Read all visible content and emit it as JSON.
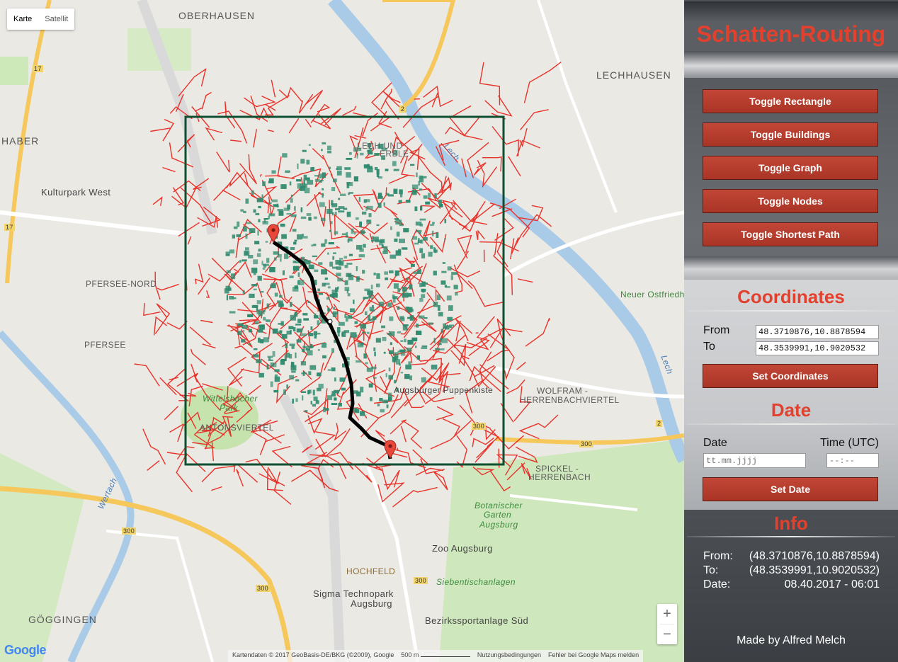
{
  "map": {
    "maptype": {
      "map_label": "Karte",
      "satellite_label": "Satellit"
    },
    "places": {
      "oberhausen": "OBERHAUSEN",
      "lechhausen": "LECHHAUSEN",
      "haber": "HABER",
      "kulturpark": "Kulturpark West",
      "pfersee_nord": "PFERSEE-NORD",
      "pfersee": "PFERSEE",
      "neuer_ostfried": "Neuer Ostfriedh",
      "wolfram": "WOLFRAM -",
      "herrenbachviertel": "HERRENBACHVIERTEL",
      "spickel": "SPICKEL -",
      "herrenbach": "HERRENBACH",
      "botanischer": "Botanischer",
      "garten": "Garten",
      "augsburg": "Augsburg",
      "zoo": "Zoo Augsburg",
      "hochfeld": "HOCHFELD",
      "siebentisch": "Siebentischanlagen",
      "sigma": "Sigma Technopark",
      "sigma2": "Augsburg",
      "bezirks": "Bezirkssportanlage Süd",
      "goeggingen": "GÖGGINGEN",
      "wittelsbacher": "Wittelsbacher",
      "park": "Park",
      "puppenkiste": "Augsburger Puppenkiste",
      "lech": "Lech",
      "wertach": "Wertach",
      "lech_nord": "LECH UND",
      "lech_nord2": "ERBLE",
      "road_17a": "17",
      "road_17b": "17",
      "road_2a": "2",
      "road_2b": "2",
      "road_300a": "300",
      "road_300b": "300",
      "road_300c": "300",
      "road_300d": "300",
      "road_300e": "300",
      "antonsviertel": "ANTONSVIERTEL"
    },
    "zoom": {
      "in": "+",
      "out": "−"
    },
    "logo": "Google",
    "attribution": {
      "data": "Kartendaten © 2017 GeoBasis-DE/BKG (©2009), Google",
      "scale": "500 m",
      "terms": "Nutzungsbedingungen",
      "report": "Fehler bei Google Maps melden"
    }
  },
  "panel": {
    "title": "Schatten-Routing",
    "buttons": {
      "toggle_rectangle": "Toggle Rectangle",
      "toggle_buildings": "Toggle Buildings",
      "toggle_graph": "Toggle Graph",
      "toggle_nodes": "Toggle Nodes",
      "toggle_shortest_path": "Toggle Shortest Path"
    },
    "coordinates": {
      "heading": "Coordinates",
      "from_label": "From",
      "from_value": "48.3710876,10.8878594",
      "to_label": "To",
      "to_value": "48.3539991,10.9020532",
      "set_button": "Set Coordinates"
    },
    "date": {
      "heading": "Date",
      "date_label": "Date",
      "time_label": "Time (UTC)",
      "date_placeholder": "tt.mm.jjjj",
      "time_placeholder": "--:--",
      "set_button": "Set Date"
    },
    "info": {
      "heading": "Info",
      "from_label": "From:",
      "from_value": "(48.3710876,10.8878594)",
      "to_label": "To:",
      "to_value": "(48.3539991,10.9020532)",
      "date_label": "Date:",
      "date_value": "08.40.2017 - 06:01"
    },
    "credit": "Made by Alfred Melch"
  },
  "colors": {
    "accent_red": "#e3402d",
    "button_red": "#b33d2e",
    "graph_red": "#e8322a",
    "building_green": "#2e8a6e",
    "rectangle_green": "#0e4f32",
    "route_black": "#000000"
  }
}
